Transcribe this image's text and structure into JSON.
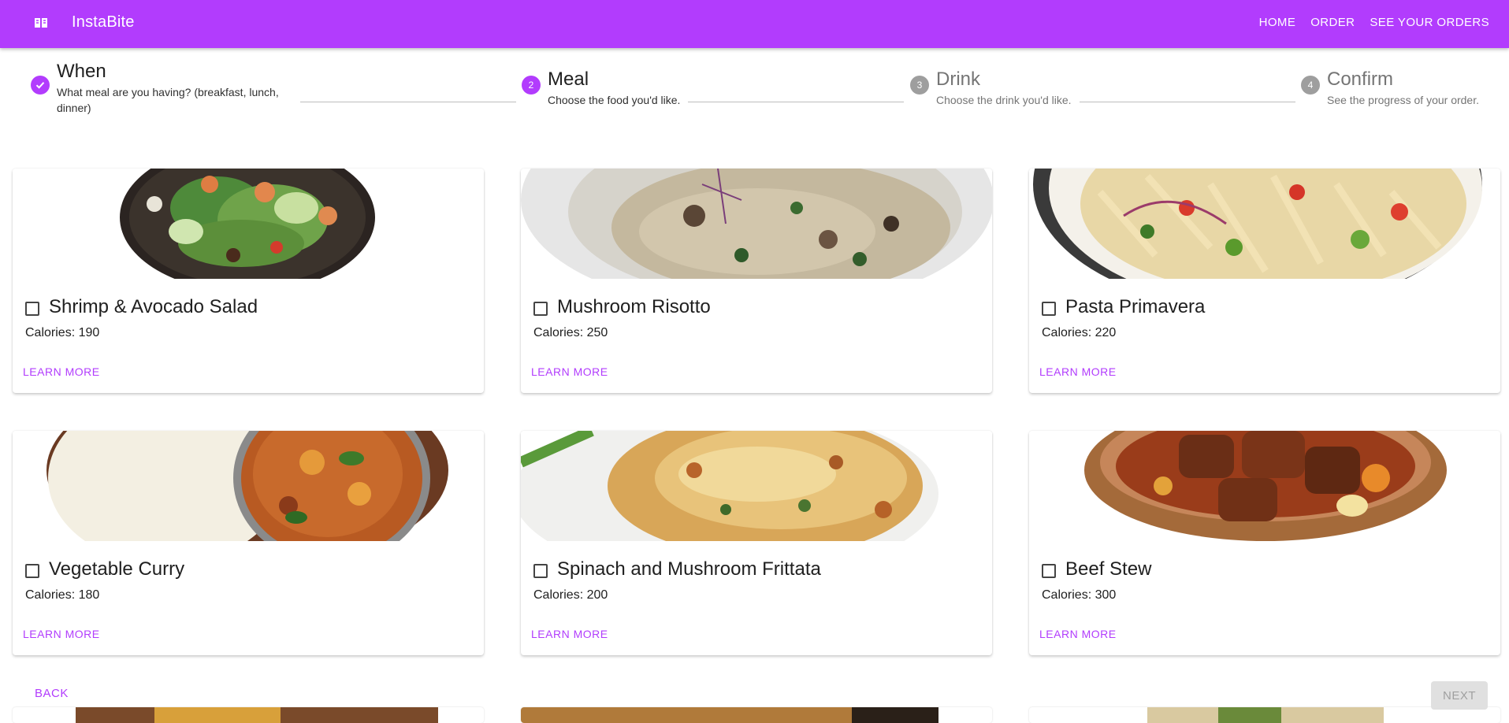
{
  "app": {
    "brand": "InstaBite",
    "logo_icon": "menu-book-icon",
    "accent_color": "#b23cfd",
    "nav": [
      "HOME",
      "ORDER",
      "SEE YOUR ORDERS"
    ]
  },
  "stepper": {
    "steps": [
      {
        "index": "1",
        "title": "When",
        "subtitle": "What meal are you having? (breakfast, lunch, dinner)",
        "state": "completed",
        "icon": "check-icon"
      },
      {
        "index": "2",
        "title": "Meal",
        "subtitle": "Choose the food you'd like.",
        "state": "active"
      },
      {
        "index": "3",
        "title": "Drink",
        "subtitle": "Choose the drink you'd like.",
        "state": "pending"
      },
      {
        "index": "4",
        "title": "Confirm",
        "subtitle": "See the progress of your order.",
        "state": "pending"
      }
    ]
  },
  "meals": [
    {
      "name": "Shrimp & Avocado Salad",
      "calories": "Calories: 190",
      "action": "LEARN MORE",
      "checked": false,
      "image": "shrimp-avocado-salad-photo"
    },
    {
      "name": "Mushroom Risotto",
      "calories": "Calories: 250",
      "action": "LEARN MORE",
      "checked": false,
      "image": "mushroom-risotto-photo"
    },
    {
      "name": "Pasta Primavera",
      "calories": "Calories: 220",
      "action": "LEARN MORE",
      "checked": false,
      "image": "pasta-primavera-photo"
    },
    {
      "name": "Vegetable Curry",
      "calories": "Calories: 180",
      "action": "LEARN MORE",
      "checked": false,
      "image": "vegetable-curry-photo"
    },
    {
      "name": "Spinach and Mushroom Frittata",
      "calories": "Calories: 200",
      "action": "LEARN MORE",
      "checked": false,
      "image": "spinach-mushroom-frittata-photo"
    },
    {
      "name": "Beef Stew",
      "calories": "Calories: 300",
      "action": "LEARN MORE",
      "checked": false,
      "image": "beef-stew-photo"
    }
  ],
  "footer": {
    "back_label": "BACK",
    "next_label": "NEXT"
  }
}
